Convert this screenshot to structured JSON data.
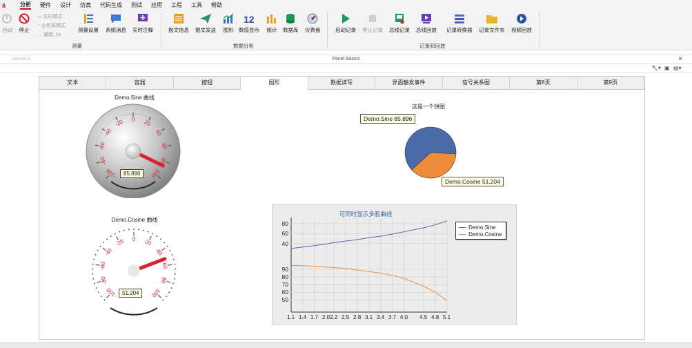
{
  "menu": {
    "items": [
      "分析",
      "硬件",
      "设计",
      "仿真",
      "代码生成",
      "测试",
      "应用",
      "工程",
      "工具",
      "帮助"
    ],
    "active": "分析"
  },
  "ribbon": {
    "measure": {
      "start": "启动",
      "stop": "停止",
      "realtime_mode": "实时模式",
      "full_sim_mode": "全仿真模式",
      "speed": "速度: 1x",
      "measure_setup": "测量设置",
      "system_msgs": "系统消息",
      "realtime_comment": "实时注释",
      "group": "测量"
    },
    "analysis": {
      "msg_info": "报文信息",
      "msg_send": "报文发送",
      "graph": "图形",
      "num_display": "数值显示",
      "stats": "统计",
      "database": "数据库",
      "gauge": "仪表盘",
      "group": "数据分析"
    },
    "record": {
      "start_rec": "启动记录",
      "stop_rec": "停止记录",
      "bus_rec": "总线记录",
      "bus_replay": "总线回放",
      "rec_convert": "记录转换器",
      "rec_folder": "记录文件夹",
      "video_replay": "视频回放",
      "group": "记录和回放"
    }
  },
  "window": {
    "timestamp": "2025-10-XX",
    "title": "Panel Basics",
    "close": "×"
  },
  "tabs": [
    "文本",
    "容器",
    "按钮",
    "图形",
    "数据读写",
    "界面触发事件",
    "信号关系图",
    "第8页",
    "第9页"
  ],
  "active_tab": "图形",
  "gauge1": {
    "title": "Demo.Sine 曲线",
    "value": "85.896",
    "value_num": 85.896,
    "ticks": [
      "-20",
      "0",
      "20",
      "40",
      "60",
      "80",
      "100",
      "-100",
      "-80",
      "-60",
      "-40"
    ]
  },
  "gauge2": {
    "title": "Demo.Cosine 曲线",
    "value": "51.204",
    "value_num": 51.204,
    "ticks": [
      "-20",
      "0",
      "20",
      "40",
      "60",
      "80",
      "100",
      "-100",
      "-80",
      "-60",
      "-40"
    ]
  },
  "pie": {
    "title": "这是一个饼图",
    "tooltip_sine": "Demo.Sine 85.896",
    "tooltip_cosine": "Demo.Cosine 51.204",
    "colors": {
      "sine": "#4a6aaa",
      "cosine": "#ef8c3a"
    }
  },
  "chart_data": {
    "type": "line",
    "title": "可同时显示多股曲线",
    "x_ticks": [
      "1.1",
      "1.4",
      "1.7",
      "2.0",
      "2.2",
      "2.5",
      "2.8",
      "3.1",
      "3.4",
      "3.7",
      "4.0",
      "4.5",
      "4.8",
      "5.1"
    ],
    "series": [
      {
        "name": "Demo.Sine",
        "color": "#4a6aaa",
        "ylim": [
          20,
          90
        ],
        "y_ticks": [
          40,
          60,
          80
        ],
        "points": [
          [
            1.1,
            30
          ],
          [
            1.4,
            33
          ],
          [
            1.7,
            36
          ],
          [
            2.0,
            39
          ],
          [
            2.2,
            42
          ],
          [
            2.5,
            45
          ],
          [
            2.8,
            48
          ],
          [
            3.1,
            52
          ],
          [
            3.4,
            55
          ],
          [
            3.7,
            59
          ],
          [
            4.0,
            64
          ],
          [
            4.5,
            72
          ],
          [
            4.8,
            78
          ],
          [
            5.1,
            86
          ]
        ]
      },
      {
        "name": "Demo.Cosine",
        "color": "#ef8c3a",
        "ylim": [
          45,
          98
        ],
        "y_ticks": [
          50,
          60,
          70,
          80,
          90
        ],
        "points": [
          [
            1.1,
            95
          ],
          [
            1.4,
            94.5
          ],
          [
            1.7,
            94
          ],
          [
            2.0,
            93
          ],
          [
            2.2,
            92
          ],
          [
            2.5,
            91
          ],
          [
            2.8,
            89
          ],
          [
            3.1,
            87
          ],
          [
            3.4,
            85
          ],
          [
            3.7,
            82
          ],
          [
            4.0,
            78
          ],
          [
            4.5,
            68
          ],
          [
            4.8,
            60
          ],
          [
            5.1,
            49
          ]
        ]
      }
    ]
  }
}
